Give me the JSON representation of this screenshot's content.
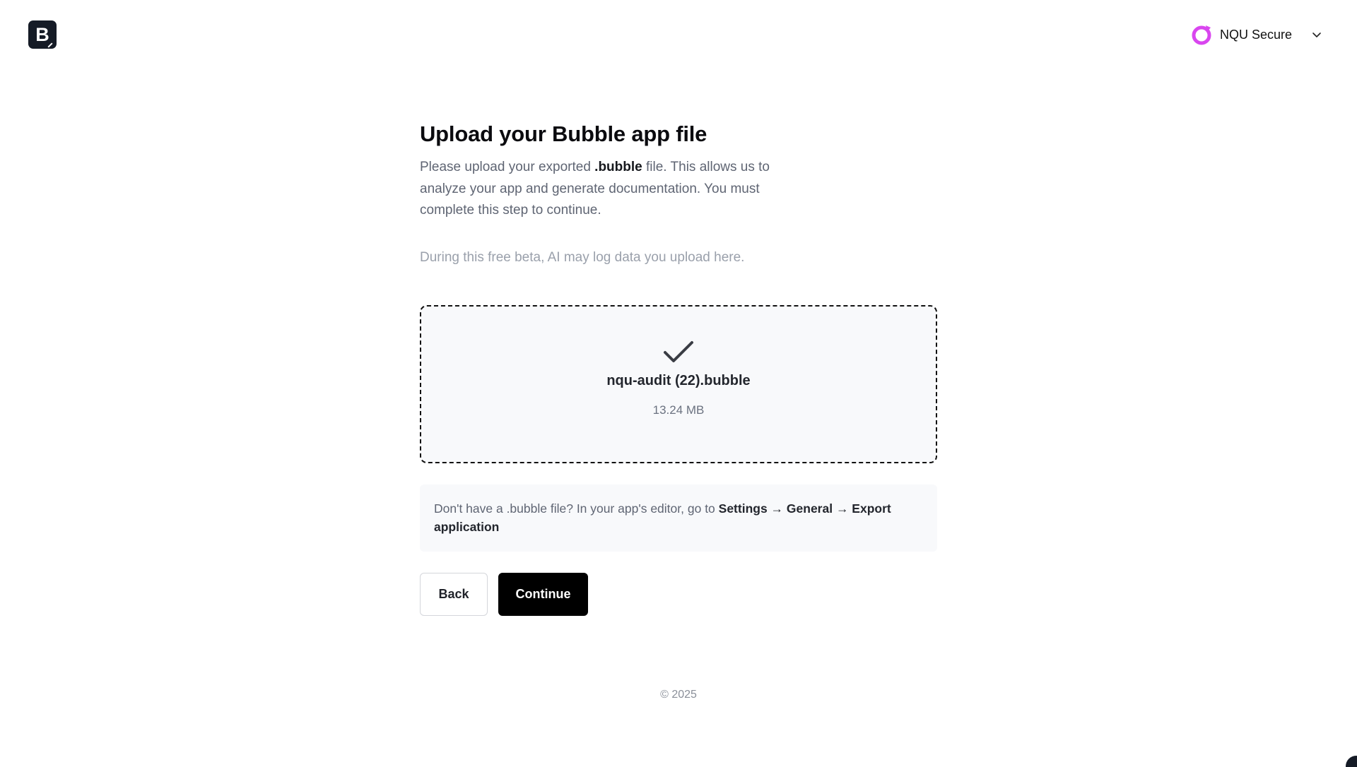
{
  "header": {
    "logo_letter": "B",
    "account_name": "NQU Secure",
    "account_color": "#d946ef"
  },
  "main": {
    "title": "Upload your Bubble app file",
    "description": {
      "part1": "Please upload your exported ",
      "highlight": ".bubble",
      "part2": " file. This allows us to analyze your app and generate documentation. You must complete this step to continue."
    },
    "beta_notice": "During this free beta, AI may log data you upload here.",
    "upload": {
      "status_icon": "check-icon",
      "file_name": "nqu-audit (22).bubble",
      "file_size": "13.24 MB"
    },
    "hint": {
      "text": "Don't have a .bubble file? In your app's editor, go to ",
      "path": "Settings → General → Export application"
    },
    "buttons": {
      "back": "Back",
      "continue": "Continue"
    }
  },
  "footer": {
    "copyright": "© 2025"
  }
}
